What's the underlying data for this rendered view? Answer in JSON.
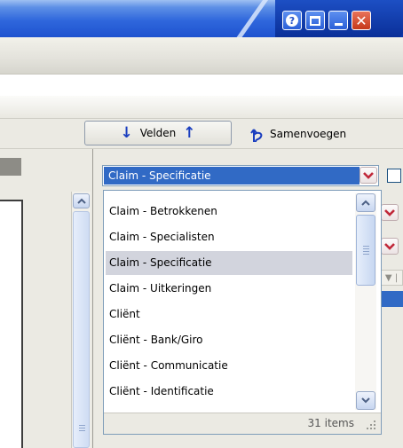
{
  "toolbar": {
    "velden_label": "Velden",
    "merge_label": "Samenvoegen"
  },
  "window_buttons": [
    "help",
    "restore",
    "minimize",
    "close"
  ],
  "view_selector": {
    "selected": "Claim - Specificatie",
    "options": [
      "Claim - Betrokkenen",
      "Claim - Specialisten",
      "Claim - Specificatie",
      "Claim - Uitkeringen",
      "Cliënt",
      "Cliënt - Bank/Giro",
      "Cliënt - Communicatie",
      "Cliënt - Identificatie"
    ],
    "highlighted_index": 2,
    "item_count": "31 items"
  },
  "icons": {
    "help": "help-icon",
    "restore": "restore-icon",
    "minimize": "minimize-icon",
    "close": "close-icon",
    "arrow_down": "arrow-down-icon",
    "arrow_up": "arrow-up-icon",
    "merge": "merge-icon",
    "dropdown": "chevron-down-icon",
    "resize": "resize-grip-icon"
  },
  "colors": {
    "titlebar": "#1a48c8",
    "selection": "#316ac5",
    "hover": "#d2d4dd",
    "close_button": "#c6391a",
    "dropdown_chevron": "#c0283a"
  }
}
